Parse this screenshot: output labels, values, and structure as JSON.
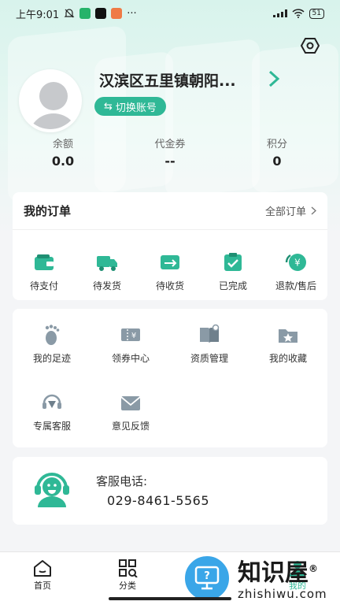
{
  "status_bar": {
    "time": "上午9:01",
    "more": "···",
    "battery": "51"
  },
  "profile": {
    "name": "汉滨区五里镇朝阳...",
    "switch_label": "切换账号",
    "switch_glyph": "⇆"
  },
  "stats": [
    {
      "label": "余额",
      "value": "0.0"
    },
    {
      "label": "代金券",
      "value": "--"
    },
    {
      "label": "积分",
      "value": "0"
    }
  ],
  "orders": {
    "title": "我的订单",
    "all_label": "全部订单",
    "items": [
      {
        "label": "待支付",
        "icon": "wallet-icon"
      },
      {
        "label": "待发货",
        "icon": "truck-icon"
      },
      {
        "label": "待收货",
        "icon": "receive-icon"
      },
      {
        "label": "已完成",
        "icon": "done-icon"
      },
      {
        "label": "退款/售后",
        "icon": "refund-icon"
      }
    ]
  },
  "services": {
    "row1": [
      {
        "label": "我的足迹",
        "icon": "footprint-icon"
      },
      {
        "label": "领券中心",
        "icon": "coupon-icon"
      },
      {
        "label": "资质管理",
        "icon": "book-icon"
      },
      {
        "label": "我的收藏",
        "icon": "favorite-folder-icon"
      }
    ],
    "row2": [
      {
        "label": "专属客服",
        "icon": "headset-icon"
      },
      {
        "label": "意见反馈",
        "icon": "mail-icon"
      }
    ]
  },
  "support": {
    "label": "客服电话:",
    "phone": "029-8461-5565"
  },
  "tabbar": [
    {
      "label": "首页",
      "icon": "home-icon"
    },
    {
      "label": "分类",
      "icon": "category-icon"
    },
    {
      "label": "",
      "icon": ""
    },
    {
      "label": "我的",
      "icon": "me-icon"
    }
  ],
  "watermark": {
    "logo_text": "知识屋",
    "domain": "zhishiwu.com",
    "reg": "®"
  },
  "colors": {
    "accent": "#2fb896",
    "hero_bg": "#d8f3ec",
    "watermark_blue": "#3aa6e8"
  }
}
